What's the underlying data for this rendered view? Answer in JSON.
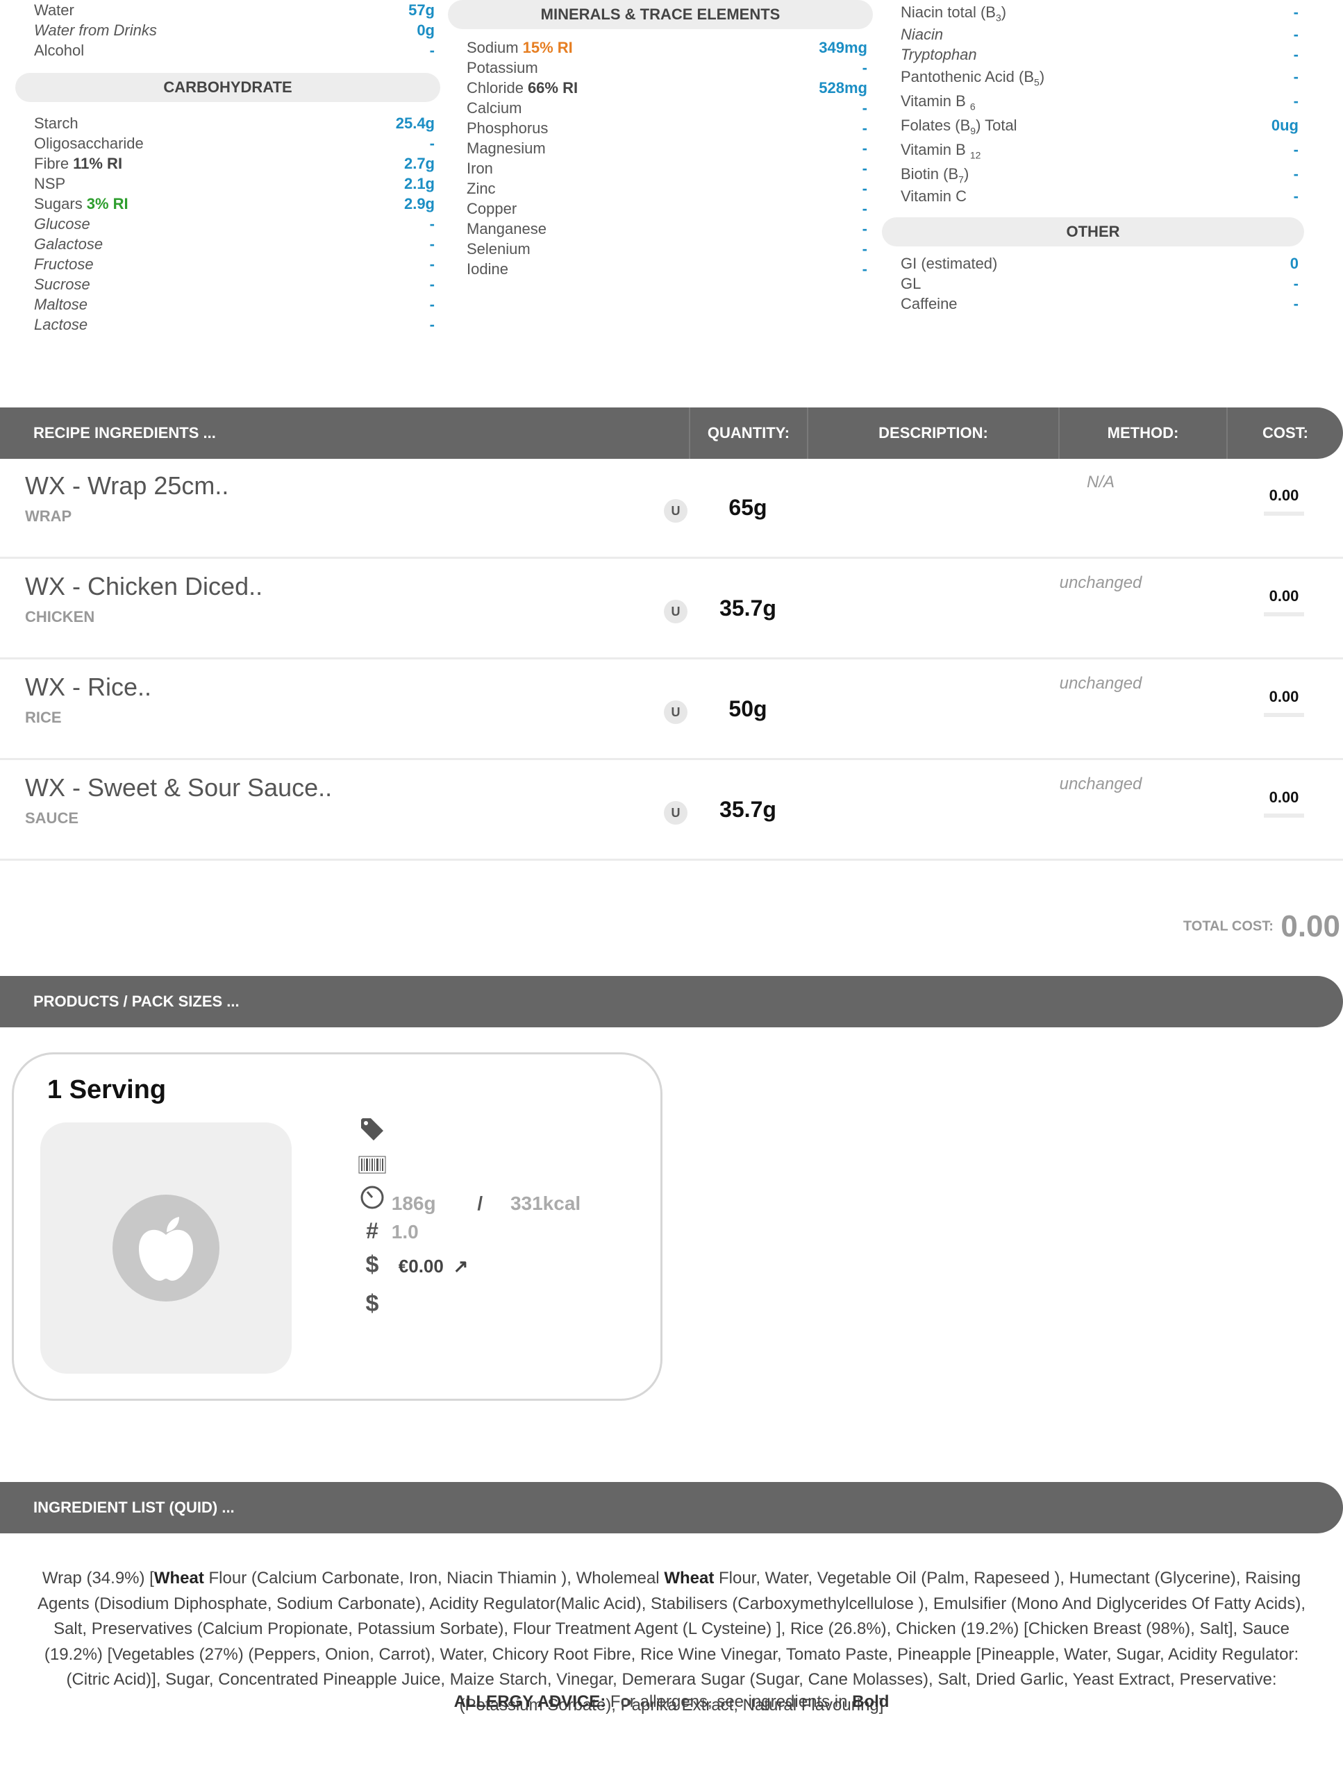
{
  "nutrients_left_top": [
    {
      "name": "Water",
      "value": "57g",
      "italic": false
    },
    {
      "name": "Water from Drinks",
      "value": "0g",
      "italic": true
    },
    {
      "name": "Alcohol",
      "value": "-",
      "italic": false
    }
  ],
  "carbohydrate": {
    "title": "CARBOHYDRATE",
    "rows": [
      {
        "name": "Starch",
        "value": "25.4g",
        "italic": false
      },
      {
        "name": "Oligosaccharide",
        "value": "-",
        "italic": false
      },
      {
        "name": "Fibre",
        "ri": "11% RI",
        "value": "2.7g",
        "italic": false
      },
      {
        "name": "NSP",
        "value": "2.1g",
        "italic": false
      },
      {
        "name": "Sugars",
        "ri": "3% RI",
        "ri_color": "green",
        "value": "2.9g",
        "italic": false
      },
      {
        "name": "Glucose",
        "value": "-",
        "italic": true
      },
      {
        "name": "Galactose",
        "value": "-",
        "italic": true
      },
      {
        "name": "Fructose",
        "value": "-",
        "italic": true
      },
      {
        "name": "Sucrose",
        "value": "-",
        "italic": true
      },
      {
        "name": "Maltose",
        "value": "-",
        "italic": true
      },
      {
        "name": "Lactose",
        "value": "-",
        "italic": true
      }
    ]
  },
  "minerals": {
    "title": "MINERALS & TRACE ELEMENTS",
    "rows": [
      {
        "name": "Sodium",
        "ri": "15% RI",
        "ri_color": "orange",
        "value": "349mg"
      },
      {
        "name": "Potassium",
        "value": "-"
      },
      {
        "name": "Chloride",
        "ri": "66% RI",
        "value": "528mg"
      },
      {
        "name": "Calcium",
        "value": "-"
      },
      {
        "name": "Phosphorus",
        "value": "-"
      },
      {
        "name": "Magnesium",
        "value": "-"
      },
      {
        "name": "Iron",
        "value": "-"
      },
      {
        "name": "Zinc",
        "value": "-"
      },
      {
        "name": "Copper",
        "value": "-"
      },
      {
        "name": "Manganese",
        "value": "-"
      },
      {
        "name": "Selenium",
        "value": "-"
      },
      {
        "name": "Iodine",
        "value": "-"
      }
    ]
  },
  "vitamins": [
    {
      "name": "Niacin total (B",
      "sub": "3",
      "suffix": ")",
      "value": "-",
      "italic": false
    },
    {
      "name": "Niacin",
      "value": "-",
      "italic": true
    },
    {
      "name": "Tryptophan",
      "value": "-",
      "italic": true
    },
    {
      "name": "Pantothenic Acid (B",
      "sub": "5",
      "suffix": ")",
      "value": "-",
      "italic": false
    },
    {
      "name": "Vitamin B ",
      "sub": "6",
      "suffix": "",
      "value": "-",
      "italic": false
    },
    {
      "name": "Folates (B",
      "sub": "9",
      "suffix": ") Total",
      "value": "0ug",
      "italic": false
    },
    {
      "name": "Vitamin B ",
      "sub": "12",
      "suffix": "",
      "value": "-",
      "italic": false
    },
    {
      "name": "Biotin (B",
      "sub": "7",
      "suffix": ")",
      "value": "-",
      "italic": false
    },
    {
      "name": "Vitamin C",
      "value": "-",
      "italic": false
    }
  ],
  "other": {
    "title": "OTHER",
    "rows": [
      {
        "name": "GI (estimated)",
        "value": "0"
      },
      {
        "name": "GL",
        "value": "-"
      },
      {
        "name": "Caffeine",
        "value": "-"
      }
    ]
  },
  "recipe_header": {
    "title": "RECIPE INGREDIENTS ...",
    "quantity": "QUANTITY:",
    "description": "DESCRIPTION:",
    "method": "METHOD:",
    "cost": "COST:"
  },
  "ingredients": [
    {
      "name": "WX - Wrap 25cm..",
      "category": "WRAP",
      "unit": "U",
      "quantity": "65g",
      "method": "N/A",
      "cost": "0.00"
    },
    {
      "name": "WX - Chicken Diced..",
      "category": "CHICKEN",
      "unit": "U",
      "quantity": "35.7g",
      "method": "unchanged",
      "cost": "0.00"
    },
    {
      "name": "WX - Rice..",
      "category": "RICE",
      "unit": "U",
      "quantity": "50g",
      "method": "unchanged",
      "cost": "0.00"
    },
    {
      "name": "WX - Sweet & Sour Sauce..",
      "category": "SAUCE",
      "unit": "U",
      "quantity": "35.7g",
      "method": "unchanged",
      "cost": "0.00"
    }
  ],
  "total_cost": {
    "label": "TOTAL COST:",
    "value": "0.00"
  },
  "products_header": {
    "title": "PRODUCTS / PACK SIZES ..."
  },
  "product_card": {
    "title": "1 Serving",
    "weight": "186g",
    "separator": "/",
    "energy": "331kcal",
    "count": "1.0",
    "price": "€0.00",
    "icons": [
      "tag-icon",
      "barcode-icon",
      "weight-dial-icon",
      "hash-icon",
      "dollar-icon",
      "trend-arrow-icon",
      "apple-icon"
    ]
  },
  "quid_header": {
    "title": "INGREDIENT LIST (QUID) ..."
  },
  "quid": {
    "parts": [
      {
        "text": "Wrap (34.9%) [",
        "bold": false
      },
      {
        "text": "Wheat",
        "bold": true
      },
      {
        "text": " Flour (Calcium Carbonate, Iron, Niacin Thiamin ), Wholemeal ",
        "bold": false
      },
      {
        "text": "Wheat",
        "bold": true
      },
      {
        "text": " Flour, Water, Vegetable Oil (Palm, Rapeseed ), Humectant (Glycerine), Raising Agents (Disodium Diphosphate, Sodium Carbonate), Acidity Regulator(Malic Acid), Stabilisers (Carboxymethylcellulose ), Emulsifier (Mono And Diglycerides Of Fatty Acids), Salt, Preservatives (Calcium Propionate, Potassium Sorbate), Flour Treatment Agent (L Cysteine) ], Rice (26.8%), Chicken (19.2%) [Chicken Breast (98%), Salt], Sauce (19.2%) [Vegetables (27%) (Peppers, Onion, Carrot), Water, Chicory Root Fibre, Rice Wine Vinegar, Tomato Paste, Pineapple [Pineapple, Water, Sugar, Acidity Regulator: (Citric Acid)], Sugar, Concentrated Pineapple Juice, Maize Starch, Vinegar, Demerara Sugar (Sugar, Cane Molasses), Salt, Dried Garlic, Yeast Extract, Preservative: (Potassium Sorbate), Paprika Extract, Natural Flavouring]",
        "bold": false
      }
    ],
    "allergy_label": "ALLERGY ADVICE:",
    "allergy_text": " For allergens, see ingredients in ",
    "allergy_bold": "Bold"
  },
  "colors": {
    "value_blue": "#1b8ec4",
    "bar_gray": "#666666",
    "pill_gray": "#ededed",
    "ri_orange": "#e67e22",
    "ri_green": "#2e9e2e"
  }
}
